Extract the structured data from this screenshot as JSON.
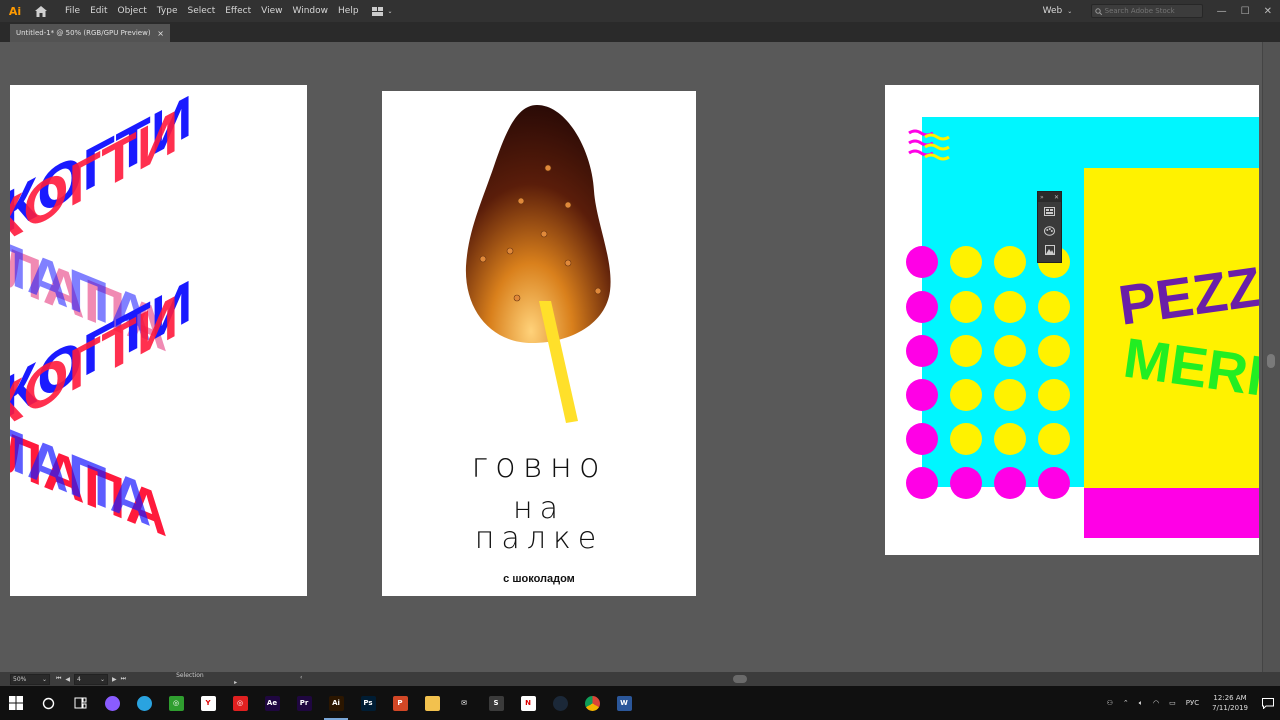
{
  "app": {
    "logo_text": "Ai"
  },
  "menu": {
    "items": [
      "File",
      "Edit",
      "Object",
      "Type",
      "Select",
      "Effect",
      "View",
      "Window",
      "Help"
    ],
    "workspace_label": "Web",
    "search_placeholder": "Search Adobe Stock"
  },
  "document_tab": {
    "title": "Untitled-1* @ 50% (RGB/GPU Preview)",
    "close": "×"
  },
  "artboard_2": {
    "line1": "говно",
    "line2": "на",
    "line3": "палке",
    "subtitle": "с шоколадом"
  },
  "artboard_3": {
    "word1": "PEZZ",
    "word2": "MERI"
  },
  "artboard_1": {
    "word_top": "когти",
    "word_bottom": "лапа"
  },
  "status_bar": {
    "zoom": "50%",
    "artboard_number": "4",
    "tool": "Selection"
  },
  "taskbar": {
    "time": "12:26 AM",
    "date": "7/11/2019",
    "language": "РУС",
    "apps": [
      {
        "name": "cortana",
        "label": "",
        "bg": "#8a5cff"
      },
      {
        "name": "telegram",
        "label": "",
        "bg": "#2aa3e0"
      },
      {
        "name": "green-app",
        "label": "◎",
        "bg": "#2f9e2f"
      },
      {
        "name": "yandex",
        "label": "Y",
        "bg": "#ffffff"
      },
      {
        "name": "red-app",
        "label": "◎",
        "bg": "#e02020"
      },
      {
        "name": "after-effects",
        "label": "Ae",
        "bg": "#1f0740"
      },
      {
        "name": "premiere",
        "label": "Pr",
        "bg": "#1f0740"
      },
      {
        "name": "illustrator",
        "label": "Ai",
        "bg": "#2b1600"
      },
      {
        "name": "photoshop",
        "label": "Ps",
        "bg": "#001d34"
      },
      {
        "name": "powerpoint",
        "label": "P",
        "bg": "#d24726"
      },
      {
        "name": "file-explorer",
        "label": "",
        "bg": "#f2c14e"
      },
      {
        "name": "mail",
        "label": "✉",
        "bg": "#101010"
      },
      {
        "name": "sublime",
        "label": "S",
        "bg": "#3b3b3b"
      },
      {
        "name": "notion",
        "label": "N",
        "bg": "#ffffff"
      },
      {
        "name": "steam",
        "label": "",
        "bg": "#1b2838"
      },
      {
        "name": "chrome",
        "label": "",
        "bg": "#101010"
      },
      {
        "name": "word",
        "label": "W",
        "bg": "#2b579a"
      }
    ]
  },
  "colors": {
    "accent_orange": "#ff9a00",
    "cyan": "#00f6ff",
    "yellow": "#fff200",
    "magenta": "#ff00e6"
  }
}
